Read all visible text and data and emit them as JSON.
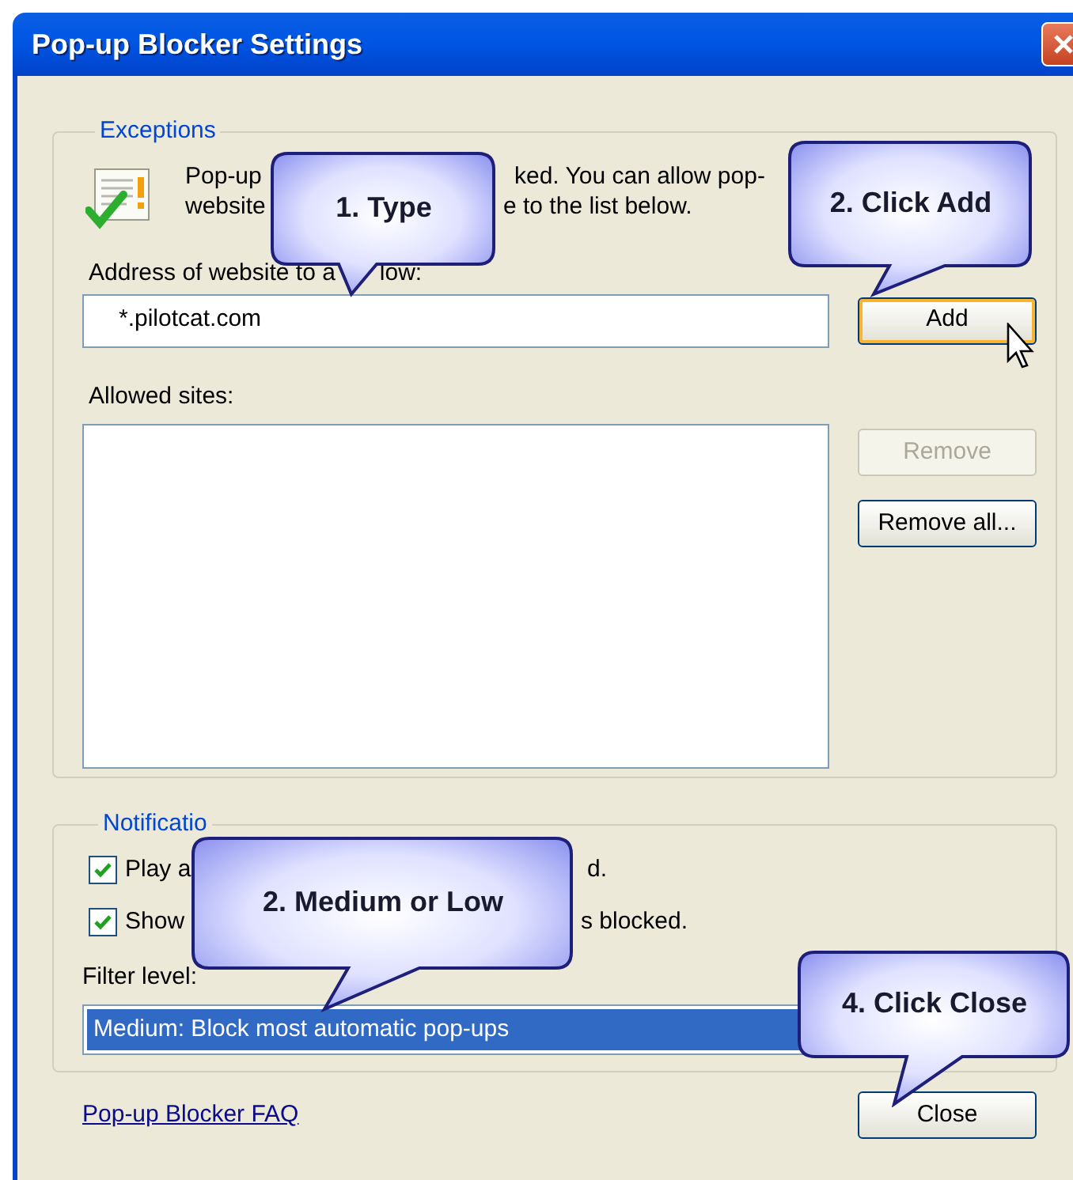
{
  "window": {
    "title": "Pop-up Blocker Settings"
  },
  "exceptions": {
    "legend": "Exceptions",
    "intro_lines": [
      [
        "Pop-up",
        "ked.  You can allow pop-"
      ],
      [
        "website",
        "e to the list below."
      ]
    ],
    "address_label": [
      "Address of website to a",
      "low:"
    ],
    "address_value": "*.pilotcat.com",
    "add_button": {
      "label": "Add",
      "highlighted": true
    },
    "allowed_label": "Allowed sites:",
    "buttons": [
      {
        "label": "Remove",
        "disabled": true
      },
      {
        "label": "Remove all...",
        "disabled": false
      }
    ]
  },
  "notifications": {
    "legend": "Notificatio",
    "options": [
      {
        "parts": [
          "Play a",
          "d."
        ],
        "checked": true
      },
      {
        "parts": [
          "Show",
          "s blocked."
        ],
        "checked": true
      }
    ],
    "filter_label": "Filter level:",
    "filter": {
      "value": "Medium: Block most automatic pop-ups",
      "selected": true
    }
  },
  "faq_link": "Pop-up Blocker FAQ",
  "close_button": "Close",
  "callouts": [
    {
      "text": "1. Type"
    },
    {
      "text": "2. Click Add"
    },
    {
      "text": "2. Medium or Low"
    },
    {
      "text": "4. Click Close"
    }
  ]
}
